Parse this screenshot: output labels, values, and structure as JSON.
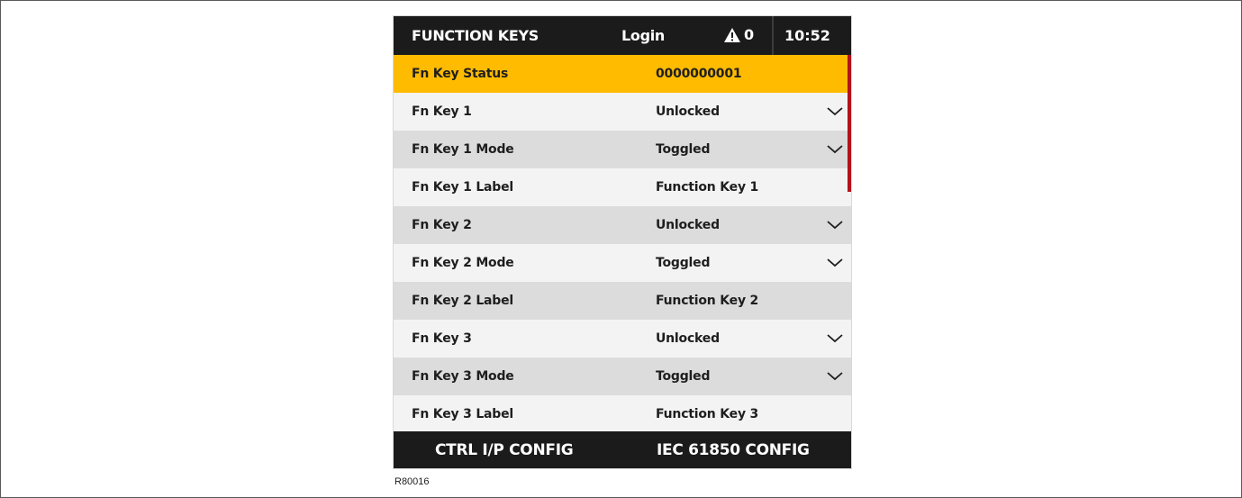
{
  "header": {
    "title": "FUNCTION KEYS",
    "login": "Login",
    "alarm_icon": "warning-triangle-icon",
    "alarm_count": "0",
    "time": "10:52"
  },
  "rows": [
    {
      "label": "Fn Key Status",
      "value": "0000000001",
      "dropdown": false,
      "selected": true
    },
    {
      "label": "Fn Key 1",
      "value": "Unlocked",
      "dropdown": true
    },
    {
      "label": "Fn Key 1 Mode",
      "value": "Toggled",
      "dropdown": true
    },
    {
      "label": "Fn Key 1 Label",
      "value": "Function Key 1",
      "dropdown": false
    },
    {
      "label": "Fn Key 2",
      "value": "Unlocked",
      "dropdown": true
    },
    {
      "label": "Fn Key 2 Mode",
      "value": "Toggled",
      "dropdown": true
    },
    {
      "label": "Fn Key 2 Label",
      "value": "Function Key 2",
      "dropdown": false
    },
    {
      "label": "Fn Key 3",
      "value": "Unlocked",
      "dropdown": true
    },
    {
      "label": "Fn Key 3 Mode",
      "value": "Toggled",
      "dropdown": true
    },
    {
      "label": "Fn Key 3 Label",
      "value": "Function Key 3",
      "dropdown": false
    }
  ],
  "softkeys": {
    "left": "CTRL I/P CONFIG",
    "right": "IEC 61850 CONFIG"
  },
  "caption": "R80016",
  "colors": {
    "bar": "#1b1b1b",
    "highlight": "#ffbb00",
    "scrollbar": "#b3121b",
    "row_light": "#f3f3f3",
    "row_dark": "#dcdcdc"
  }
}
